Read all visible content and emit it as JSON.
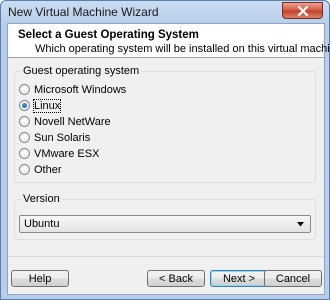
{
  "window": {
    "title": "New Virtual Machine Wizard"
  },
  "header": {
    "title": "Select a Guest Operating System",
    "subtitle": "Which operating system will be installed on this virtual machine?"
  },
  "guest_os": {
    "label": "Guest operating system",
    "options": [
      {
        "label": "Microsoft Windows",
        "selected": false
      },
      {
        "label": "Linux",
        "selected": true
      },
      {
        "label": "Novell NetWare",
        "selected": false
      },
      {
        "label": "Sun Solaris",
        "selected": false
      },
      {
        "label": "VMware ESX",
        "selected": false
      },
      {
        "label": "Other",
        "selected": false
      }
    ]
  },
  "version": {
    "label": "Version",
    "selected": "Ubuntu"
  },
  "buttons": {
    "help": "Help",
    "back": "< Back",
    "next": "Next >",
    "cancel": "Cancel"
  },
  "icons": {
    "close": "close-icon",
    "dropdown": "chevron-down-icon"
  },
  "colors": {
    "accent": "#3c7fb1",
    "close_button": "#c23d26"
  }
}
